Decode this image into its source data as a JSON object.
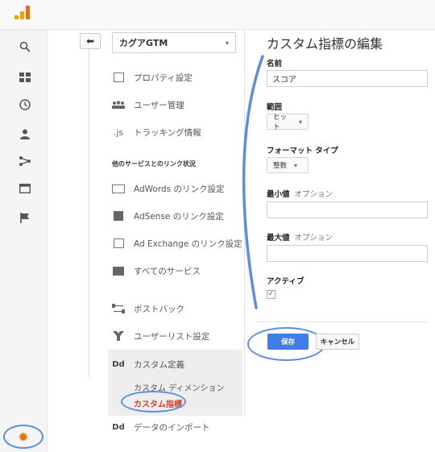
{
  "app": {
    "back_glyph": "⬅",
    "property_name": "カグアGTM"
  },
  "colors": {
    "accent_blue": "#3e7ee6",
    "highlight_circle": "#5a8fe0",
    "active_red": "#d23f31",
    "gear_orange": "#e8710a",
    "logo_orange": "#f4a100"
  },
  "left_rail": {
    "icons": [
      "search-icon",
      "dashboard-icon",
      "clock-icon",
      "person-icon",
      "share-icon",
      "browser-icon",
      "flag-icon"
    ],
    "settings_icon": "gear-icon"
  },
  "sidebar": {
    "items": [
      {
        "label": "プロパティ設定",
        "icon": "property-icon"
      },
      {
        "label": "ユーザー管理",
        "icon": "users-icon"
      },
      {
        "label": "トラッキング情報",
        "icon_text": ".js"
      }
    ],
    "section_label": "他のサービスとのリンク状況",
    "linked_services": [
      {
        "label": "AdWords のリンク設定",
        "icon": "adwords-icon"
      },
      {
        "label": "AdSense のリンク設定",
        "icon": "adsense-icon"
      },
      {
        "label": "Ad Exchange のリンク設定",
        "icon": "adexchange-icon"
      },
      {
        "label": "すべてのサービス",
        "icon": "services-icon"
      }
    ],
    "postback": "ポストバック",
    "user_list": "ユーザーリスト設定",
    "custom_definition": {
      "icon_text": "Dd",
      "label": "カスタム定義",
      "dimension": "カスタム ディメンション",
      "metric": "カスタム指標"
    },
    "data_import": {
      "icon_text": "Dd",
      "label": "データのインポート"
    }
  },
  "form": {
    "title": "カスタム指標の編集",
    "name_label": "名前",
    "name_value": "スコア",
    "scope_label": "範囲",
    "scope_value": "ヒット",
    "format_label": "フォーマット タイプ",
    "format_value": "整数",
    "min_label": "最小値",
    "max_label": "最大値",
    "optional": "オプション",
    "active_label": "アクティブ",
    "active_check": "✓",
    "save": "保存",
    "cancel": "キャンセル"
  }
}
